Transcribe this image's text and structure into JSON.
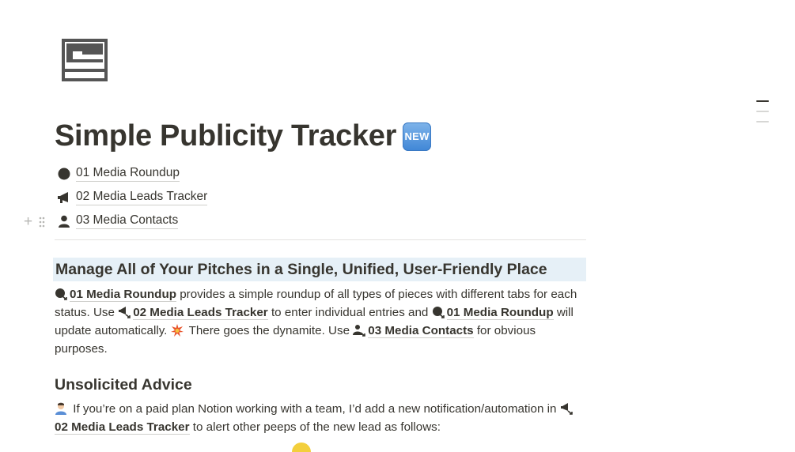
{
  "page": {
    "icon": "window-layout-icon",
    "title": "Simple Publicity Tracker",
    "title_badge": "NEW"
  },
  "links": [
    {
      "icon": "circle-icon",
      "label": "01 Media Roundup"
    },
    {
      "icon": "megaphone-icon",
      "label": "02 Media Leads Tracker"
    },
    {
      "icon": "person-icon",
      "label": "03 Media Contacts"
    }
  ],
  "section1": {
    "heading": "Manage All of Your Pitches in a Single, Unified, User-Friendly Place",
    "p1_link": "01 Media Roundup",
    "p1_text1": " provides a simple roundup of all types of pieces with different tabs for each status. Use ",
    "p1_link2": "02 Media Leads Tracker",
    "p1_text2": " to enter individual entries and ",
    "p1_link3": "01 Media Roundup",
    "p1_text3": " will update automatically. ",
    "p1_text4": " There goes the dynamite. Use ",
    "p1_link4": "03 Media Contacts",
    "p1_text5": " for obvious purposes."
  },
  "section2": {
    "heading": "Unsolicited Advice",
    "p_text1": " If you’re on a paid plan Notion working with a team, I’d add a new notification/automation in ",
    "p_link": "02 Media Leads Tracker",
    "p_text2": " to alert other peeps of the new lead as follows:"
  },
  "colors": {
    "text": "#37352f",
    "heading_highlight": "#e6f0f7",
    "badge_blue": "#3f86d6"
  }
}
